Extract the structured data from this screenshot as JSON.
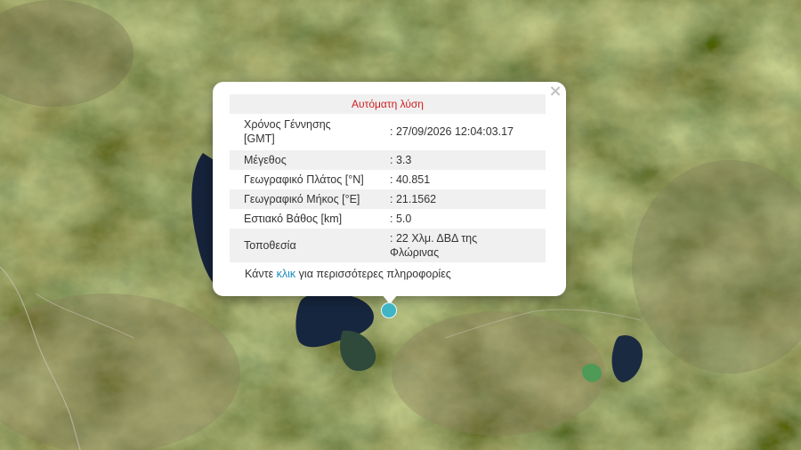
{
  "popup": {
    "title": "Αυτόματη λύση",
    "close_symbol": "×",
    "rows": [
      {
        "label": "Χρόνος Γέννησης [GMT]",
        "value": ": 27/09/2026 12:04:03.17"
      },
      {
        "label": "Μέγεθος",
        "value": ": 3.3"
      },
      {
        "label": "Γεωγραφικό Πλάτος [°N]",
        "value": ": 40.851"
      },
      {
        "label": "Γεωγραφικό Μήκος [°E]",
        "value": ": 21.1562"
      },
      {
        "label": "Εστιακό Βάθος [km]",
        "value": ": 5.0"
      },
      {
        "label": "Τοποθεσία",
        "value": ": 22 Χλμ. ΔΒΔ της Φλώρινας"
      }
    ],
    "more_prefix": "Κάντε ",
    "more_link": "κλικ",
    "more_suffix": " για περισσότερες πληροφορίες"
  },
  "colors": {
    "title_red": "#cc1f1f",
    "link_blue": "#1b8cbf",
    "marker": "#3fb4c4",
    "row_shade": "#f0f0f0"
  },
  "icons": [
    "close-icon",
    "earthquake-marker-icon"
  ]
}
